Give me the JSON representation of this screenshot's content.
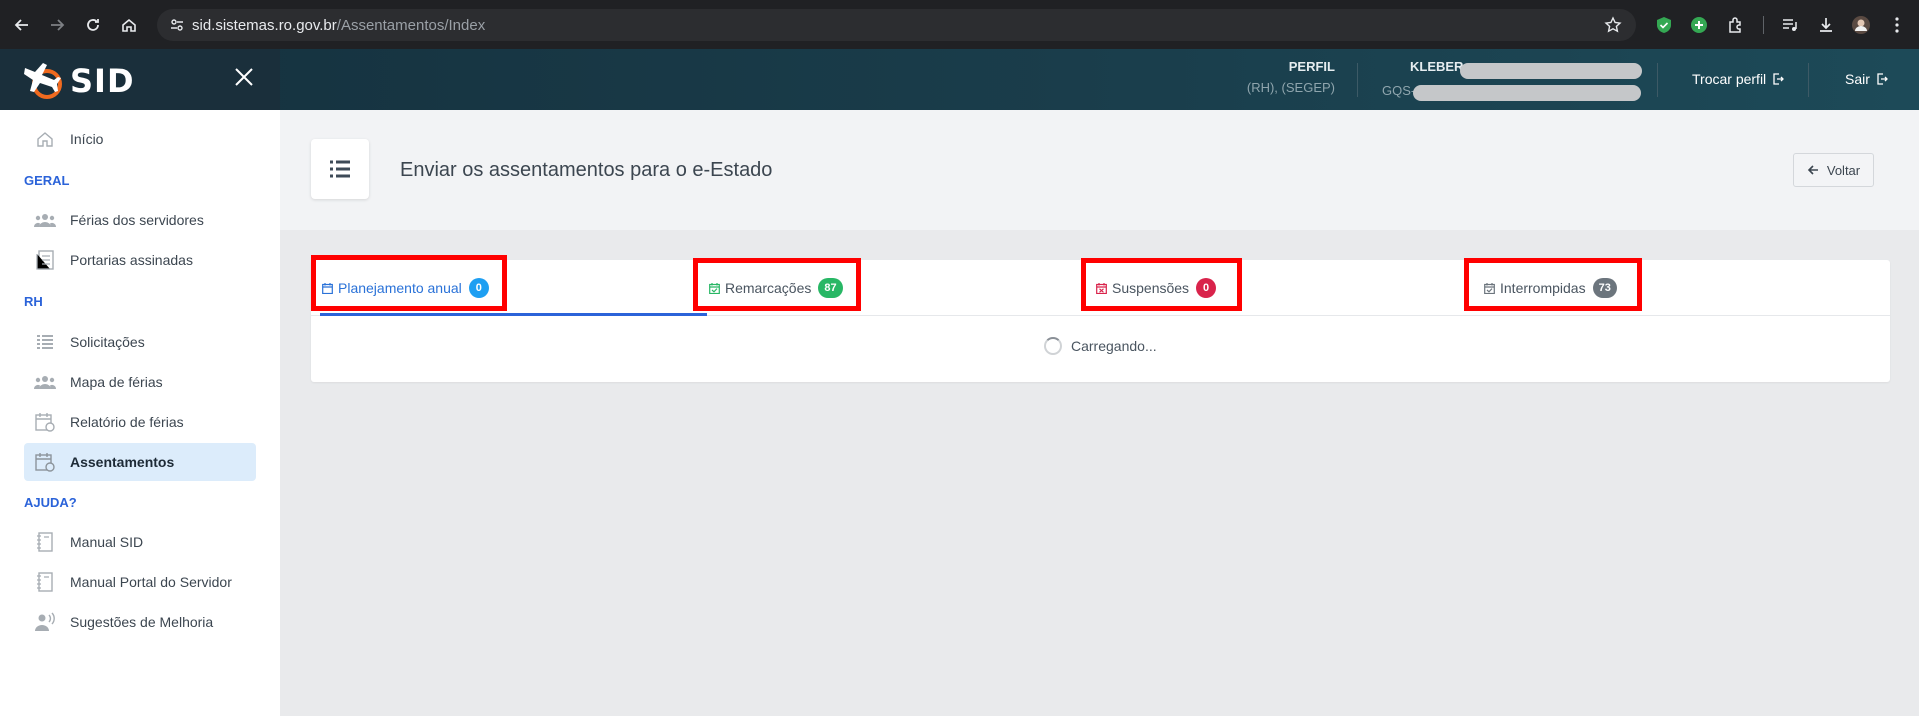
{
  "browser": {
    "url_host": "sid.sistemas.ro.gov.br",
    "url_path": "/Assentamentos/Index"
  },
  "header": {
    "logo": "SID",
    "perfil_label": "PERFIL",
    "perfil_value": "(RH), (SEGEP)",
    "user_name": "KLEBER",
    "user_org": "GQS-",
    "trocar_perfil": "Trocar perfil",
    "sair": "Sair"
  },
  "sidebar": {
    "inicio": "Início",
    "sections": [
      {
        "title": "GERAL",
        "items": [
          "Férias dos servidores",
          "Portarias assinadas"
        ]
      },
      {
        "title": "RH",
        "items": [
          "Solicitações",
          "Mapa de férias",
          "Relatório de férias",
          "Assentamentos"
        ]
      },
      {
        "title": "AJUDA?",
        "items": [
          "Manual SID",
          "Manual Portal do Servidor",
          "Sugestões de Melhoria"
        ]
      }
    ],
    "active_item": "Assentamentos"
  },
  "page": {
    "title": "Enviar os assentamentos para o e-Estado",
    "back_label": "Voltar"
  },
  "tabs": [
    {
      "label": "Planejamento anual",
      "count": "0",
      "badge_color": "#1e9ff2"
    },
    {
      "label": "Remarcações",
      "count": "87",
      "badge_color": "#28b765"
    },
    {
      "label": "Suspensões",
      "count": "0",
      "badge_color": "#d9234b"
    },
    {
      "label": "Interrompidas",
      "count": "73",
      "badge_color": "#6c757d"
    }
  ],
  "loading_text": "Carregando...",
  "colors": {
    "accent": "#2b63d9",
    "highlight": "#ff0000"
  }
}
